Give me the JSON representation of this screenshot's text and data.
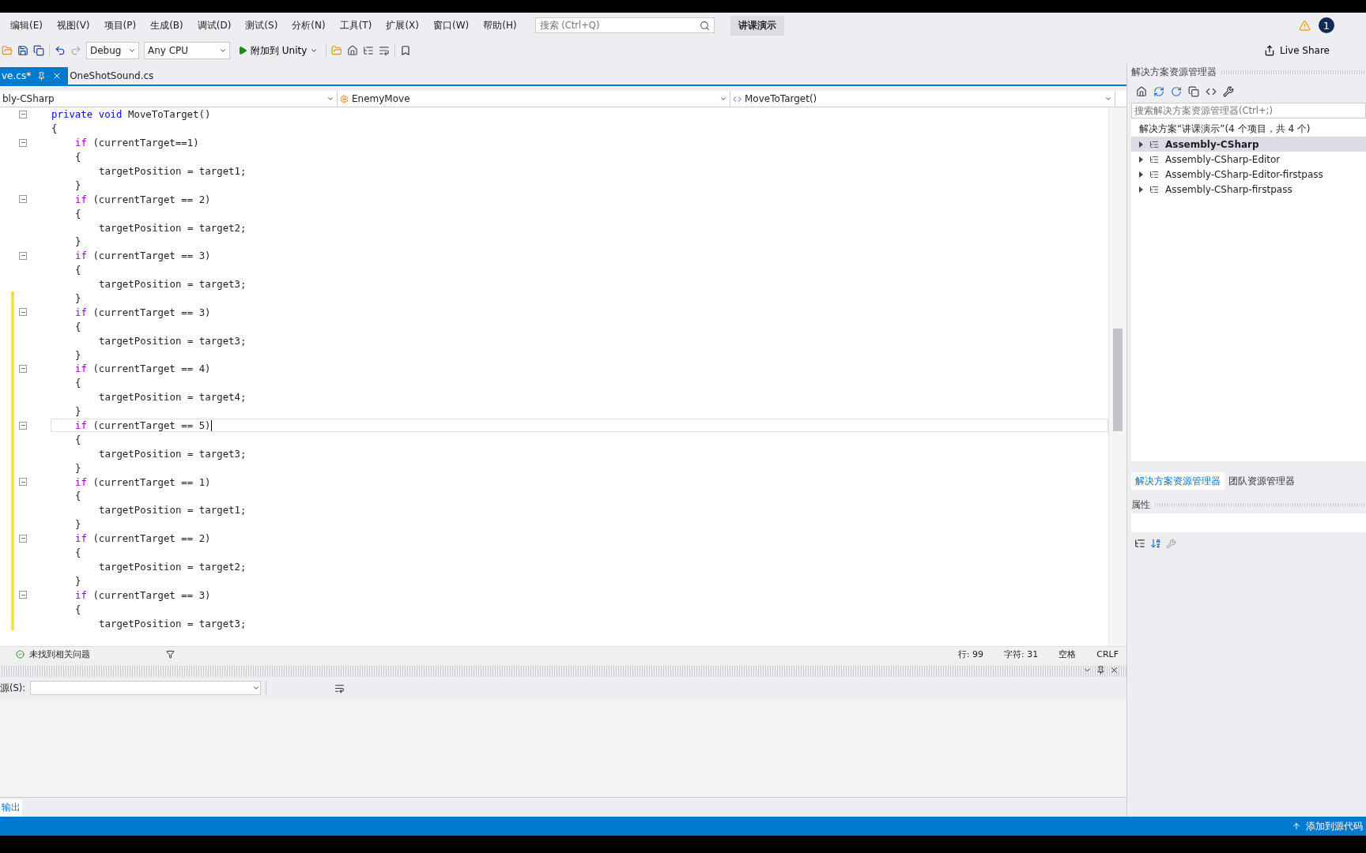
{
  "menu": [
    "编辑(E)",
    "视图(V)",
    "项目(P)",
    "生成(B)",
    "调试(D)",
    "测试(S)",
    "分析(N)",
    "工具(T)",
    "扩展(X)",
    "窗口(W)",
    "帮助(H)"
  ],
  "search": {
    "placeholder": "搜索 (Ctrl+Q)"
  },
  "solution_title": "讲课演示",
  "notification_count": "1",
  "toolbar": {
    "configuration": "Debug",
    "platform": "Any CPU",
    "run": "附加到 Unity",
    "live_share": "Live Share"
  },
  "tabs": [
    {
      "label": "ve.cs*",
      "selected": true
    },
    {
      "label": "OneShotSound.cs",
      "selected": false
    }
  ],
  "navigation": {
    "project": "bly-CSharp",
    "type": "EnemyMove",
    "member": "MoveToTarget()"
  },
  "code": [
    {
      "kind": "method",
      "keyword": "private void",
      "rest": "MoveToTarget()",
      "changed": false,
      "selected": false
    },
    {
      "kind": "outer_brace",
      "text": "{",
      "changed": false,
      "selected": false
    },
    {
      "kind": "if",
      "keyword": "if",
      "rest": "(currentTarget==1)",
      "changed": false,
      "selected": false
    },
    {
      "kind": "brace",
      "text": "{",
      "changed": false,
      "selected": false
    },
    {
      "kind": "statement",
      "text": "targetPosition = target1;",
      "changed": false,
      "selected": false
    },
    {
      "kind": "brace",
      "text": "}",
      "changed": false,
      "selected": false
    },
    {
      "kind": "if",
      "keyword": "if",
      "rest": "(currentTarget == 2)",
      "changed": false,
      "selected": false
    },
    {
      "kind": "brace",
      "text": "{",
      "changed": false,
      "selected": false
    },
    {
      "kind": "statement",
      "text": "targetPosition = target2;",
      "changed": false,
      "selected": false
    },
    {
      "kind": "brace",
      "text": "}",
      "changed": false,
      "selected": false
    },
    {
      "kind": "if",
      "keyword": "if",
      "rest": "(currentTarget == 3)",
      "changed": false,
      "selected": false
    },
    {
      "kind": "brace",
      "text": "{",
      "changed": false,
      "selected": false
    },
    {
      "kind": "statement",
      "text": "targetPosition = target3;",
      "changed": false,
      "selected": false
    },
    {
      "kind": "brace",
      "text": "}",
      "changed": true,
      "selected": false
    },
    {
      "kind": "if",
      "keyword": "if",
      "rest": "(currentTarget == 3)",
      "changed": true,
      "selected": false
    },
    {
      "kind": "brace",
      "text": "{",
      "changed": true,
      "selected": false
    },
    {
      "kind": "statement",
      "text": "targetPosition = target3;",
      "changed": true,
      "selected": false
    },
    {
      "kind": "brace",
      "text": "}",
      "changed": true,
      "selected": false
    },
    {
      "kind": "if",
      "keyword": "if",
      "rest": "(currentTarget == 4)",
      "changed": true,
      "selected": false
    },
    {
      "kind": "brace",
      "text": "{",
      "changed": true,
      "selected": false
    },
    {
      "kind": "statement",
      "text": "targetPosition = target4;",
      "changed": true,
      "selected": false
    },
    {
      "kind": "brace",
      "text": "}",
      "changed": true,
      "selected": false
    },
    {
      "kind": "if",
      "keyword": "if",
      "rest": "(currentTarget == 5)",
      "changed": true,
      "selected": true
    },
    {
      "kind": "brace",
      "text": "{",
      "changed": true,
      "selected": false
    },
    {
      "kind": "statement",
      "text": "targetPosition = target3;",
      "changed": true,
      "selected": false
    },
    {
      "kind": "brace",
      "text": "}",
      "changed": true,
      "selected": false
    },
    {
      "kind": "if",
      "keyword": "if",
      "rest": "(currentTarget == 1)",
      "changed": true,
      "selected": false
    },
    {
      "kind": "brace",
      "text": "{",
      "changed": true,
      "selected": false
    },
    {
      "kind": "statement",
      "text": "targetPosition = target1;",
      "changed": true,
      "selected": false
    },
    {
      "kind": "brace",
      "text": "}",
      "changed": true,
      "selected": false
    },
    {
      "kind": "if",
      "keyword": "if",
      "rest": "(currentTarget == 2)",
      "changed": true,
      "selected": false
    },
    {
      "kind": "brace",
      "text": "{",
      "changed": true,
      "selected": false
    },
    {
      "kind": "statement",
      "text": "targetPosition = target2;",
      "changed": true,
      "selected": false
    },
    {
      "kind": "brace",
      "text": "}",
      "changed": true,
      "selected": false
    },
    {
      "kind": "if",
      "keyword": "if",
      "rest": "(currentTarget == 3)",
      "changed": true,
      "selected": false
    },
    {
      "kind": "brace",
      "text": "{",
      "changed": true,
      "selected": false
    },
    {
      "kind": "statement",
      "text": "targetPosition = target3;",
      "changed": true,
      "selected": false
    }
  ],
  "editor_status": {
    "issues": "未找到相关问题",
    "line": "行: 99",
    "char": "字符: 31",
    "spaces": "空格",
    "eol": "CRLF"
  },
  "output": {
    "source_label": "源(S):",
    "tab": "输出"
  },
  "solution_explorer": {
    "title": "解决方案资源管理器",
    "search_placeholder": "搜索解决方案资源管理器(Ctrl+;)",
    "root": "解决方案“讲课演示”(4 个项目，共 4 个)",
    "items": [
      {
        "label": "Assembly-CSharp",
        "selected": true
      },
      {
        "label": "Assembly-CSharp-Editor",
        "selected": false
      },
      {
        "label": "Assembly-CSharp-Editor-firstpass",
        "selected": false
      },
      {
        "label": "Assembly-CSharp-firstpass",
        "selected": false
      }
    ],
    "tabs": [
      {
        "label": "解决方案资源管理器",
        "selected": true
      },
      {
        "label": "团队资源管理器",
        "selected": false
      }
    ]
  },
  "properties": {
    "title": "属性"
  },
  "status_bar": {
    "text": "添加到源代码"
  }
}
